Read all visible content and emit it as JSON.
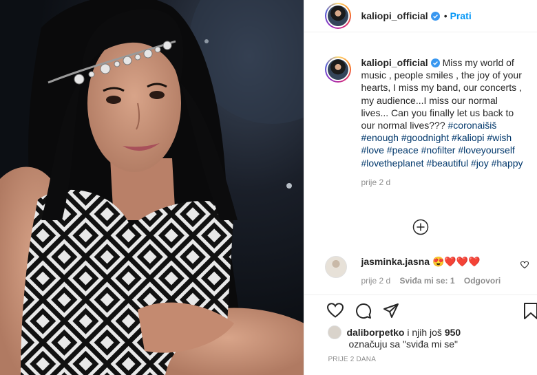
{
  "header": {
    "username": "kaliopi_official",
    "follow_label": "Prati",
    "separator": "•"
  },
  "caption": {
    "username": "kaliopi_official",
    "text": "Miss my world of music , people smiles , the joy of your hearts, I miss my band, our concerts , my audience...I miss our normal lives... Can you finally let us back to our normal lives???",
    "hashtags": [
      "#coronaišiš",
      "#enough",
      "#goodnight",
      "#kaliopi",
      "#wish",
      "#love",
      "#peace",
      "#nofilter",
      "#loveyourself",
      "#lovetheplanet",
      "#beautiful",
      "#joy",
      "#happy"
    ],
    "time": "prije 2 d"
  },
  "comment": {
    "username": "jasminka.jasna",
    "emojis": "😍❤️❤️❤️",
    "time": "prije 2 d",
    "likes": "Sviđa mi se: 1",
    "reply": "Odgovori"
  },
  "likes": {
    "liker": "daliborpetko",
    "connector": "i njih još",
    "count": "950",
    "subtext": "označuju sa \"sviđa mi se\""
  },
  "post_date": "PRIJE 2 DANA",
  "colors": {
    "link_blue": "#0095f6",
    "hashtag": "#00376b",
    "muted": "#8e8e8e",
    "border": "#efefef"
  },
  "icons": [
    "verified-badge-icon",
    "add-comment-icon",
    "like-heart-icon",
    "comment-icon",
    "share-icon",
    "save-bookmark-icon",
    "comment-like-icon"
  ]
}
